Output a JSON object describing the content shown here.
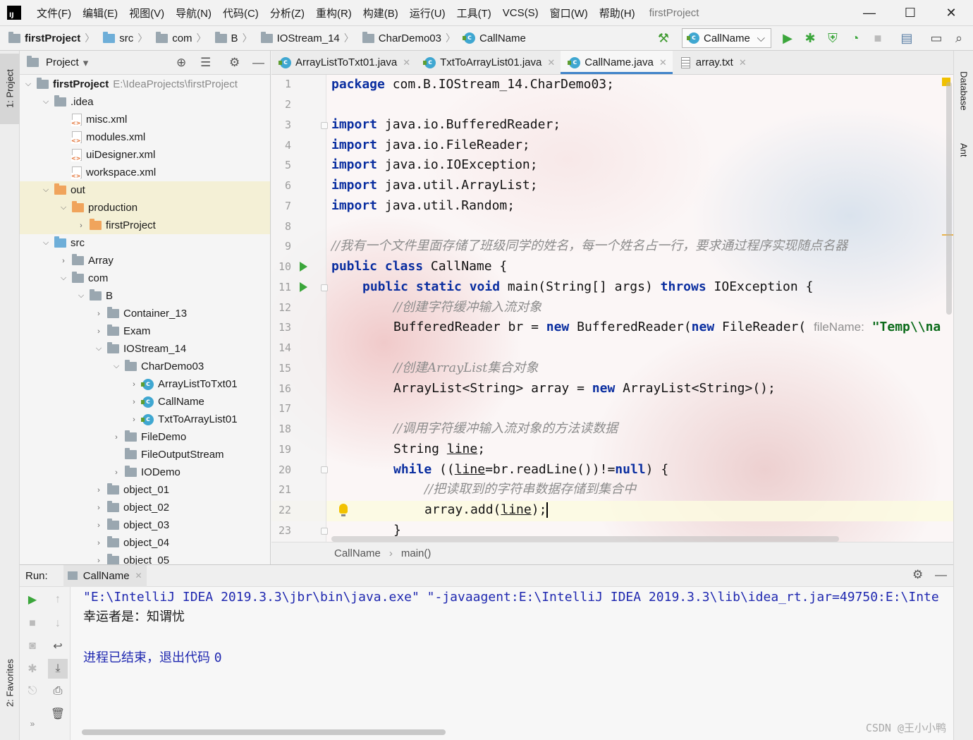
{
  "menu": {
    "items": [
      "文件(F)",
      "编辑(E)",
      "视图(V)",
      "导航(N)",
      "代码(C)",
      "分析(Z)",
      "重构(R)",
      "构建(B)",
      "运行(U)",
      "工具(T)",
      "VCS(S)",
      "窗口(W)",
      "帮助(H)"
    ],
    "project_title": "firstProject",
    "minimize": "—",
    "maximize": "☐",
    "close": "✕"
  },
  "nav": {
    "crumbs": [
      "firstProject",
      "src",
      "com",
      "B",
      "IOStream_14",
      "CharDemo03",
      "CallName"
    ],
    "run_config": "CallName",
    "run_config_arrow": "⌵"
  },
  "stripe": {
    "project": "1: Project",
    "favorites": "2: Favorites",
    "database": "Database",
    "ant": "Ant"
  },
  "project_panel": {
    "title": "Project",
    "title_arrow": "▾",
    "rows": [
      {
        "label": "firstProject",
        "extra": "E:\\IdeaProjects\\firstProject"
      },
      {
        "label": ".idea"
      },
      {
        "label": "misc.xml"
      },
      {
        "label": "modules.xml"
      },
      {
        "label": "uiDesigner.xml"
      },
      {
        "label": "workspace.xml"
      },
      {
        "label": "out"
      },
      {
        "label": "production"
      },
      {
        "label": "firstProject"
      },
      {
        "label": "src"
      },
      {
        "label": "Array"
      },
      {
        "label": "com"
      },
      {
        "label": "B"
      },
      {
        "label": "Container_13"
      },
      {
        "label": "Exam"
      },
      {
        "label": "IOStream_14"
      },
      {
        "label": "CharDemo03"
      },
      {
        "label": "ArrayListToTxt01"
      },
      {
        "label": "CallName"
      },
      {
        "label": "TxtToArrayList01"
      },
      {
        "label": "FileDemo"
      },
      {
        "label": "FileOutputStream"
      },
      {
        "label": "IODemo"
      },
      {
        "label": "object_01"
      },
      {
        "label": "object_02"
      },
      {
        "label": "object_03"
      },
      {
        "label": "object_04"
      },
      {
        "label": "object_05"
      }
    ]
  },
  "tabs": [
    {
      "label": "ArrayListToTxt01.java",
      "close": "✕"
    },
    {
      "label": "TxtToArrayList01.java",
      "close": "✕"
    },
    {
      "label": "CallName.java",
      "close": "✕"
    },
    {
      "label": "array.txt",
      "close": "✕"
    }
  ],
  "editor": {
    "line_numbers": [
      "1",
      "2",
      "3",
      "4",
      "5",
      "6",
      "7",
      "8",
      "9",
      "10",
      "11",
      "12",
      "13",
      "14",
      "15",
      "16",
      "17",
      "18",
      "19",
      "20",
      "21",
      "22",
      "23"
    ],
    "l1_kw": "package",
    "l1_rest": " com.B.IOStream_14.CharDemo03;",
    "l3_kw": "import",
    "l3_rest": " java.io.BufferedReader;",
    "l4_kw": "import",
    "l4_rest": " java.io.FileReader;",
    "l5_kw": "import",
    "l5_rest": " java.io.IOException;",
    "l6_kw": "import",
    "l6_rest": " java.util.ArrayList;",
    "l7_kw": "import",
    "l7_rest": " java.util.Random;",
    "l9_comment": "//我有一个文件里面存储了班级同学的姓名，每一个姓名占一行，要求通过程序实现随点名器",
    "l10_kw": "public class",
    "l10_rest": " CallName {",
    "l11_kw1": "public static void",
    "l11_mid": " main(String[] args) ",
    "l11_kw2": "throws",
    "l11_rest": " IOException {",
    "l12_comment": "//创建字符缓冲输入流对象",
    "l13_a": "BufferedReader br = ",
    "l13_new1": "new",
    "l13_b": " BufferedReader(",
    "l13_new2": "new",
    "l13_c": " FileReader( ",
    "l13_hint": "fileName:",
    "l13_str": " \"Temp\\\\na",
    "l15_comment": "//创建ArrayList集合对象",
    "l16_a": "ArrayList<String> array = ",
    "l16_new": "new",
    "l16_b": " ArrayList<String>();",
    "l18_comment": "//调用字符缓冲输入流对象的方法读数据",
    "l19_a": "String ",
    "l19_var": "line",
    "l19_b": ";",
    "l20_kw": "while",
    "l20_a": " ((",
    "l20_var": "line",
    "l20_b": "=br.readLine())!=",
    "l20_null": "null",
    "l20_c": ") {",
    "l21_comment": "//把读取到的字符串数据存储到集合中",
    "l22_a": "array.add(",
    "l22_var": "line",
    "l22_b": ");",
    "l23": "}"
  },
  "editor_breadcrumb": {
    "class": "CallName",
    "sep": "›",
    "method": "main()"
  },
  "run_panel": {
    "label": "Run:",
    "tab": "CallName",
    "tab_close": "✕",
    "line1": "\"E:\\IntelliJ IDEA 2019.3.3\\jbr\\bin\\java.exe\" \"-javaagent:E:\\IntelliJ IDEA 2019.3.3\\lib\\idea_rt.jar=49750:E:\\Inte",
    "line2": "幸运者是：知谓忧",
    "line3_text": "进程已结束，退出代码 ",
    "line3_code": "0"
  },
  "watermark": "CSDN @王小小鸭"
}
